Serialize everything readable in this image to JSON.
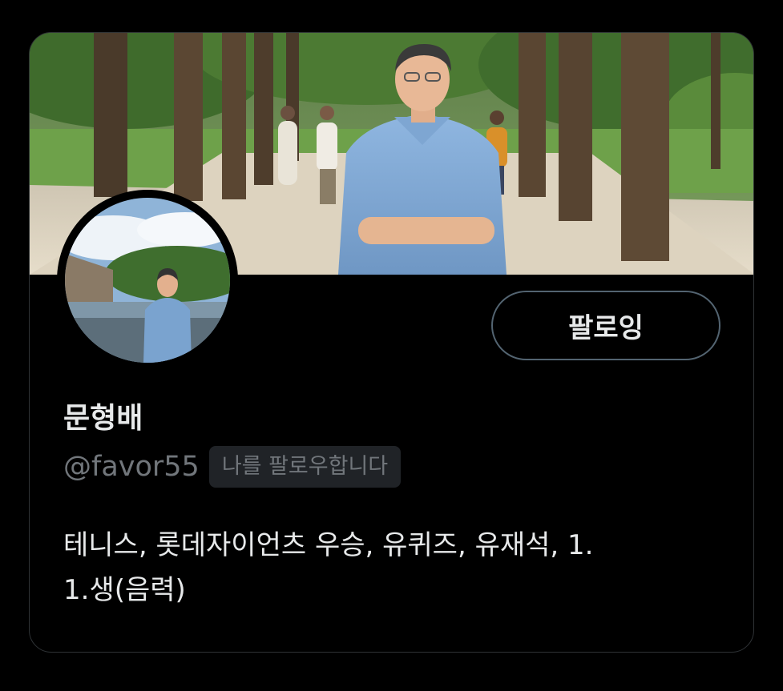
{
  "profile": {
    "display_name": "문형배",
    "handle": "@favor55",
    "follows_you_badge": "나를 팔로우합니다",
    "bio": "테니스, 롯데자이언츠 우승, 유퀴즈, 유재석,  1.\n1.생(음력)"
  },
  "actions": {
    "follow_label": "팔로잉"
  },
  "colors": {
    "background": "#000000",
    "primary_text": "#e7e9ea",
    "secondary_text": "#71767b",
    "border": "#2f3336",
    "badge_bg": "#202327",
    "button_border": "#536471"
  },
  "icons": {
    "banner": "banner-photo",
    "avatar": "avatar-photo"
  }
}
